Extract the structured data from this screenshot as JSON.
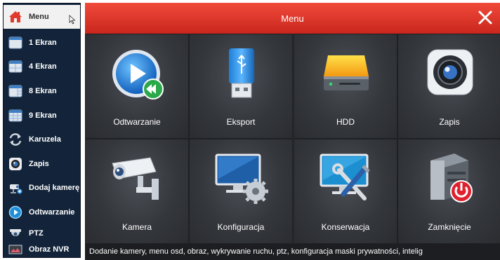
{
  "sidebar": {
    "items": [
      {
        "label": "Menu",
        "icon": "home-icon"
      },
      {
        "label": "1 Ekran",
        "icon": "screen-layout-icon"
      },
      {
        "label": "4 Ekran",
        "icon": "screen-layout-icon"
      },
      {
        "label": "8 Ekran",
        "icon": "screen-layout-icon"
      },
      {
        "label": "9 Ekran",
        "icon": "screen-layout-icon"
      },
      {
        "label": "Karuzela",
        "icon": "cycle-arrows-icon"
      },
      {
        "label": "Zapis",
        "icon": "camera-lens-icon"
      },
      {
        "label": "Dodaj kamerę",
        "icon": "add-camera-icon"
      },
      {
        "label": "Odtwarzanie",
        "icon": "play-icon"
      },
      {
        "label": "PTZ",
        "icon": "dome-camera-icon"
      },
      {
        "label": "Obraz NVR",
        "icon": "nvr-image-icon"
      }
    ]
  },
  "window": {
    "title": "Menu",
    "close_icon": "close-icon",
    "accent": "#e2362a"
  },
  "tiles": [
    {
      "label": "Odtwarzanie",
      "icon": "playback-icon"
    },
    {
      "label": "Eksport",
      "icon": "usb-drive-icon"
    },
    {
      "label": "HDD",
      "icon": "hard-drive-icon"
    },
    {
      "label": "Zapis",
      "icon": "camera-lens-icon"
    },
    {
      "label": "Kamera",
      "icon": "cctv-camera-icon"
    },
    {
      "label": "Konfiguracja",
      "icon": "monitor-gear-icon"
    },
    {
      "label": "Konserwacja",
      "icon": "monitor-tools-icon"
    },
    {
      "label": "Zamknięcie",
      "icon": "server-power-icon"
    }
  ],
  "statusbar": {
    "text": "Dodanie kamery, menu osd, obraz, wykrywanie ruchu, ptz, konfiguracja maski prywatności, intelig"
  }
}
